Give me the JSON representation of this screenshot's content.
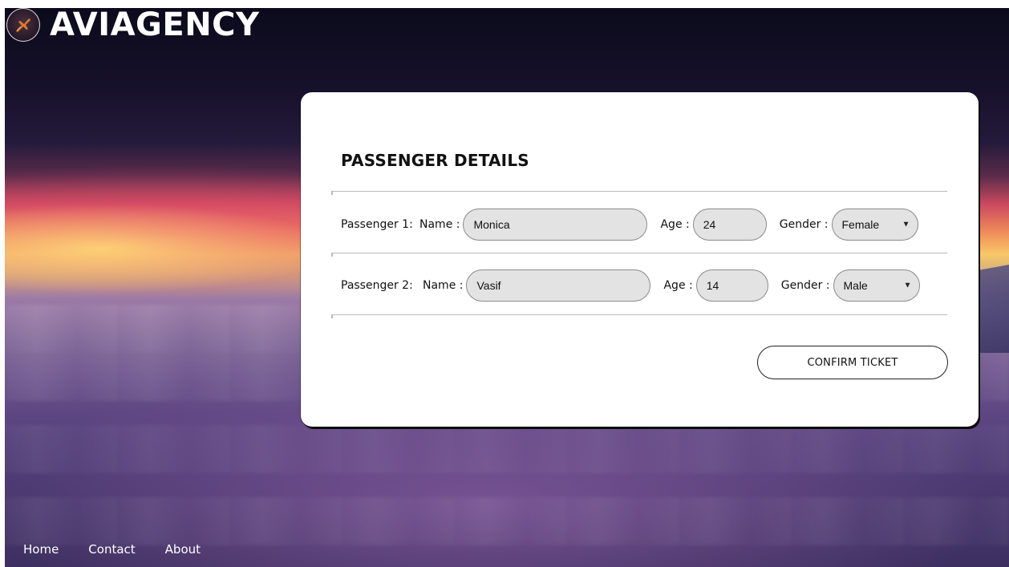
{
  "brand": {
    "name": "AVIAGENCY",
    "logo_icon": "plane-emblem-icon"
  },
  "colors": {
    "accent_orange": "#e07a2a",
    "card_bg": "#ffffff",
    "input_bg": "#e3e3e3"
  },
  "form": {
    "title": "PASSENGER DETAILS",
    "name_label": "Name :",
    "age_label": "Age :",
    "gender_label": "Gender :",
    "passengers": [
      {
        "label": "Passenger 1:",
        "name": "Monica",
        "age": "24",
        "gender": "Female"
      },
      {
        "label": "Passenger 2:",
        "name": "Vasif",
        "age": "14",
        "gender": "Male"
      }
    ],
    "confirm_label": "CONFIRM TICKET"
  },
  "footer": {
    "links": [
      "Home",
      "Contact",
      "About"
    ]
  }
}
